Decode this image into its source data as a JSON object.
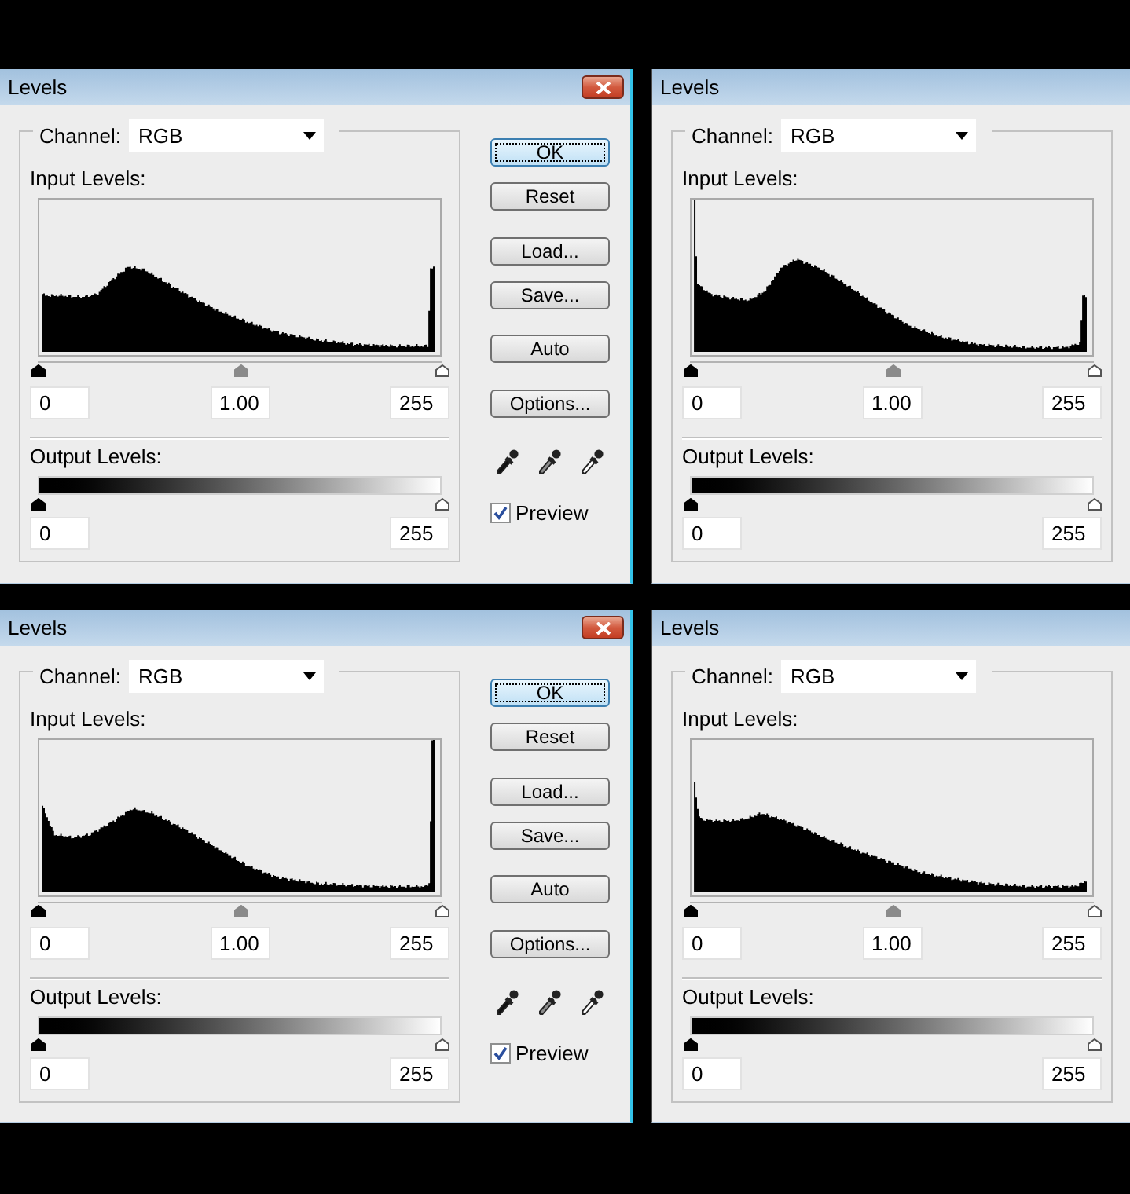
{
  "dialogs": [
    {
      "title": "Levels",
      "close_button": true,
      "channel": {
        "label": "Channel:",
        "value": "RGB"
      },
      "input_levels": {
        "label": "Input Levels:",
        "handles": [
          {
            "kind": "shadow",
            "level": 0
          },
          {
            "kind": "midtone",
            "level": 0.5
          },
          {
            "kind": "highlight",
            "level": 1
          }
        ],
        "fields": [
          "0",
          "1.00",
          "255"
        ]
      },
      "output_levels": {
        "label": "Output Levels:",
        "handles": [
          {
            "kind": "shadow",
            "level": 0
          },
          {
            "kind": "highlight",
            "level": 1
          }
        ],
        "fields": [
          "0",
          "255"
        ]
      },
      "buttons": [
        {
          "label": "OK",
          "focused": true
        },
        {
          "label": "Reset",
          "focused": false
        },
        {
          "label": "Load...",
          "focused": false
        },
        {
          "label": "Save...",
          "focused": false
        },
        {
          "label": "Auto",
          "focused": false
        },
        {
          "label": "Options...",
          "focused": false
        }
      ],
      "preview": {
        "label": "Preview",
        "checked": true
      }
    },
    {
      "title": "Levels",
      "close_button": false,
      "channel": {
        "label": "Channel:",
        "value": "RGB"
      },
      "input_levels": {
        "label": "Input Levels:",
        "handles": [
          {
            "kind": "shadow",
            "level": 0
          },
          {
            "kind": "midtone",
            "level": 0.5
          },
          {
            "kind": "highlight",
            "level": 1
          }
        ],
        "fields": [
          "0",
          "1.00",
          "255"
        ]
      },
      "output_levels": {
        "label": "Output Levels:",
        "handles": [
          {
            "kind": "shadow",
            "level": 0
          },
          {
            "kind": "highlight",
            "level": 1
          }
        ],
        "fields": [
          "0",
          "255"
        ]
      }
    },
    {
      "title": "Levels",
      "close_button": true,
      "channel": {
        "label": "Channel:",
        "value": "RGB"
      },
      "input_levels": {
        "label": "Input Levels:",
        "handles": [
          {
            "kind": "shadow",
            "level": 0
          },
          {
            "kind": "midtone",
            "level": 0.5
          },
          {
            "kind": "highlight",
            "level": 1
          }
        ],
        "fields": [
          "0",
          "1.00",
          "255"
        ]
      },
      "output_levels": {
        "label": "Output Levels:",
        "handles": [
          {
            "kind": "shadow",
            "level": 0
          },
          {
            "kind": "highlight",
            "level": 1
          }
        ],
        "fields": [
          "0",
          "255"
        ]
      },
      "buttons": [
        {
          "label": "OK",
          "focused": true
        },
        {
          "label": "Reset",
          "focused": false
        },
        {
          "label": "Load...",
          "focused": false
        },
        {
          "label": "Save...",
          "focused": false
        },
        {
          "label": "Auto",
          "focused": false
        },
        {
          "label": "Options...",
          "focused": false
        }
      ],
      "preview": {
        "label": "Preview",
        "checked": true
      }
    },
    {
      "title": "Levels",
      "close_button": false,
      "channel": {
        "label": "Channel:",
        "value": "RGB"
      },
      "input_levels": {
        "label": "Input Levels:",
        "handles": [
          {
            "kind": "shadow",
            "level": 0
          },
          {
            "kind": "midtone",
            "level": 0.5
          },
          {
            "kind": "highlight",
            "level": 1
          }
        ],
        "fields": [
          "0",
          "1.00",
          "255"
        ]
      },
      "output_levels": {
        "label": "Output Levels:",
        "handles": [
          {
            "kind": "shadow",
            "level": 0
          },
          {
            "kind": "highlight",
            "level": 1
          }
        ],
        "fields": [
          "0",
          "255"
        ]
      }
    }
  ]
}
